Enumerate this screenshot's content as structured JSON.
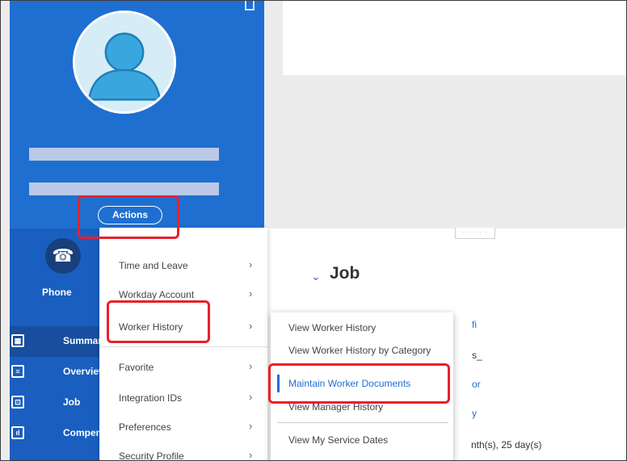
{
  "profile": {
    "actions_label": "Actions",
    "avatar_icon": "person-avatar-icon",
    "collapse_icon": "collapse-icon"
  },
  "quick_action": {
    "icon": "phone-icon",
    "label": "Phone"
  },
  "nav": {
    "items": [
      {
        "label": "Summary",
        "icon": "grid-icon"
      },
      {
        "label": "Overview",
        "icon": "document-icon"
      },
      {
        "label": "Job",
        "icon": "briefcase-icon"
      },
      {
        "label": "Compensation",
        "icon": "chart-icon"
      }
    ]
  },
  "actions_menu": {
    "items": [
      {
        "label": "Time and Leave"
      },
      {
        "label": "Workday Account"
      },
      {
        "label": "Worker History"
      },
      {
        "label": "Favorite"
      },
      {
        "label": "Integration IDs"
      },
      {
        "label": "Preferences"
      },
      {
        "label": "Security Profile"
      }
    ]
  },
  "worker_history_submenu": {
    "items": [
      {
        "label": "View Worker History"
      },
      {
        "label": "View Worker History by Category"
      },
      {
        "label": "Maintain Worker Documents"
      },
      {
        "label": "View Manager History"
      },
      {
        "label": "View My Service Dates"
      }
    ],
    "selected": "Maintain Worker Documents"
  },
  "job_section": {
    "title": "Job",
    "fragments": [
      "fi",
      "s_",
      "or",
      "y",
      "nth(s), 25 day(s)"
    ]
  },
  "colors": {
    "brand_blue": "#1f6fd1",
    "nav_blue": "#1a5fbf",
    "highlight_red": "#e8202a"
  }
}
